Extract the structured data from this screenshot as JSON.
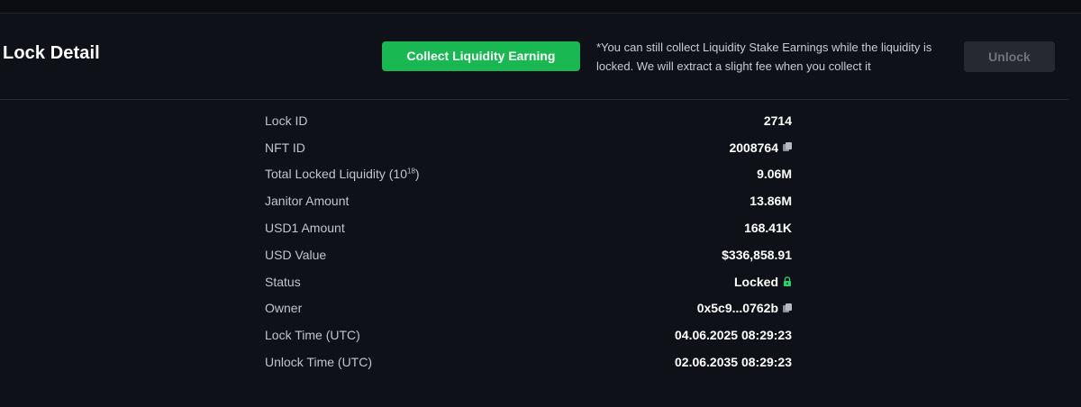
{
  "page": {
    "title": "Lock Detail"
  },
  "actions": {
    "collect_label": "Collect Liquidity Earning",
    "note": "*You can still collect Liquidity Stake Earnings while the liquidity is locked. We will extract a slight fee when you collect it",
    "unlock_label": "Unlock",
    "collect_color": "#1ab853"
  },
  "details": {
    "lock_id": {
      "label": "Lock ID",
      "value": "2714"
    },
    "nft_id": {
      "label": "NFT ID",
      "value": "2008764",
      "icon": "copy-icon"
    },
    "total_locked": {
      "label": "Total Locked Liquidity (10",
      "exp": "18",
      "label_end": ")",
      "value": "9.06M"
    },
    "janitor": {
      "label": "Janitor Amount",
      "value": "13.86M"
    },
    "usd1": {
      "label": "USD1 Amount",
      "value": "168.41K"
    },
    "usd_value": {
      "label": "USD Value",
      "value": "$336,858.91"
    },
    "status": {
      "label": "Status",
      "value": "Locked",
      "icon": "lock-icon",
      "color": "#2fd06a"
    },
    "owner": {
      "label": "Owner",
      "value": "0x5c9...0762b",
      "icon": "copy-icon"
    },
    "lock_time": {
      "label": "Lock Time (UTC)",
      "value": "04.06.2025 08:29:23"
    },
    "unlock_time": {
      "label": "Unlock Time (UTC)",
      "value": "02.06.2035 08:29:23"
    }
  }
}
